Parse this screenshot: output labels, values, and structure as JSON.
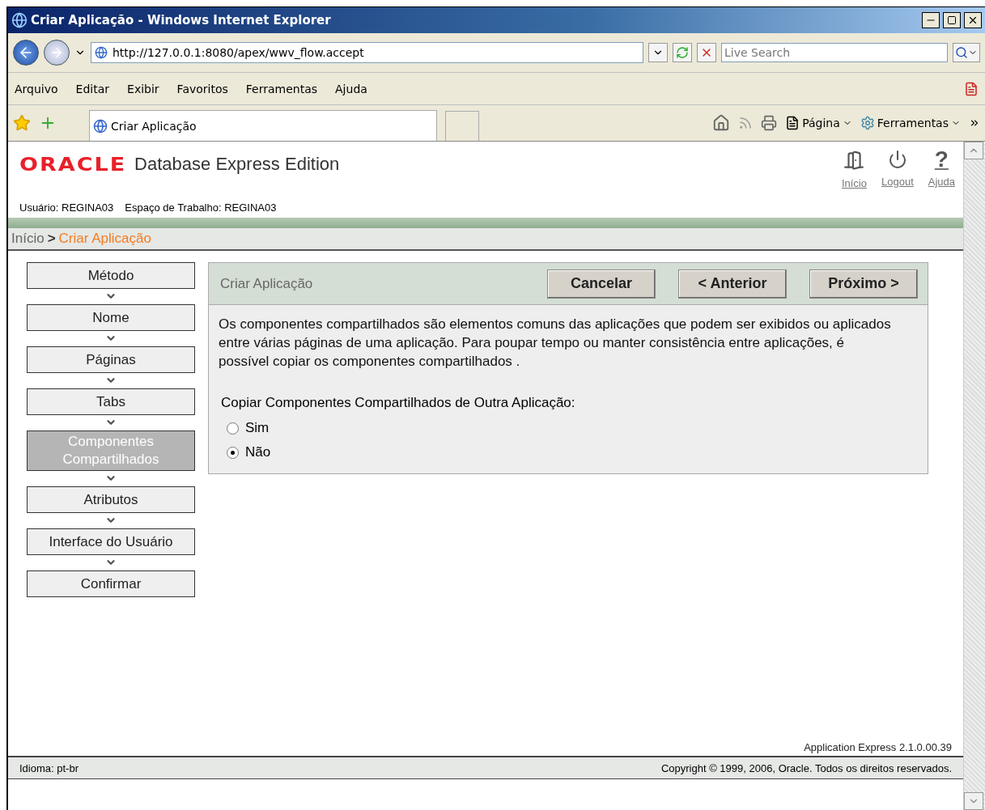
{
  "window": {
    "title": "Criar Aplicação - Windows Internet Explorer"
  },
  "address_bar": {
    "url": "http://127.0.0.1:8080/apex/wwv_flow.accept",
    "search_placeholder": "Live Search"
  },
  "menu": [
    "Arquivo",
    "Editar",
    "Exibir",
    "Favoritos",
    "Ferramentas",
    "Ajuda"
  ],
  "tab": {
    "title": "Criar Aplicação"
  },
  "command_bar": {
    "page_label": "Página",
    "tools_label": "Ferramentas"
  },
  "header": {
    "logo": "ORACLE",
    "product": "Database Express Edition",
    "user": "Usuário: REGINA03",
    "workspace": "Espaço de Trabalho: REGINA03",
    "links": [
      {
        "kind": "home",
        "label": "Início"
      },
      {
        "kind": "logout",
        "label": "Logout"
      },
      {
        "kind": "help",
        "label": "Ajuda",
        "glyph": "?"
      }
    ]
  },
  "breadcrumb": {
    "root": "Início",
    "separator": ">",
    "current": "Criar Aplicação"
  },
  "steps": [
    {
      "label": "Método",
      "selected": false
    },
    {
      "label": "Nome",
      "selected": false
    },
    {
      "label": "Páginas",
      "selected": false
    },
    {
      "label": "Tabs",
      "selected": false
    },
    {
      "label": "Componentes Compartilhados",
      "selected": true
    },
    {
      "label": "Atributos",
      "selected": false
    },
    {
      "label": "Interface do Usuário",
      "selected": false
    },
    {
      "label": "Confirmar",
      "selected": false
    }
  ],
  "region": {
    "title": "Criar Aplicação",
    "buttons": [
      "Cancelar",
      "< Anterior",
      "Próximo >"
    ],
    "description": "Os componentes compartilhados são elementos comuns das aplicações que podem ser exibidos ou aplicados entre várias páginas de uma aplicação. Para poupar tempo ou manter consistência entre aplicações, é possível copiar os componentes compartilhados .",
    "question": "Copiar Componentes Compartilhados de Outra Aplicação:",
    "options": [
      {
        "label": "Sim",
        "selected": false
      },
      {
        "label": "Não",
        "selected": true
      }
    ]
  },
  "footer": {
    "version": "Application Express 2.1.0.00.39",
    "language": "Idioma: pt-br",
    "copyright": "Copyright © 1999, 2006, Oracle. Todos os direitos reservados."
  }
}
